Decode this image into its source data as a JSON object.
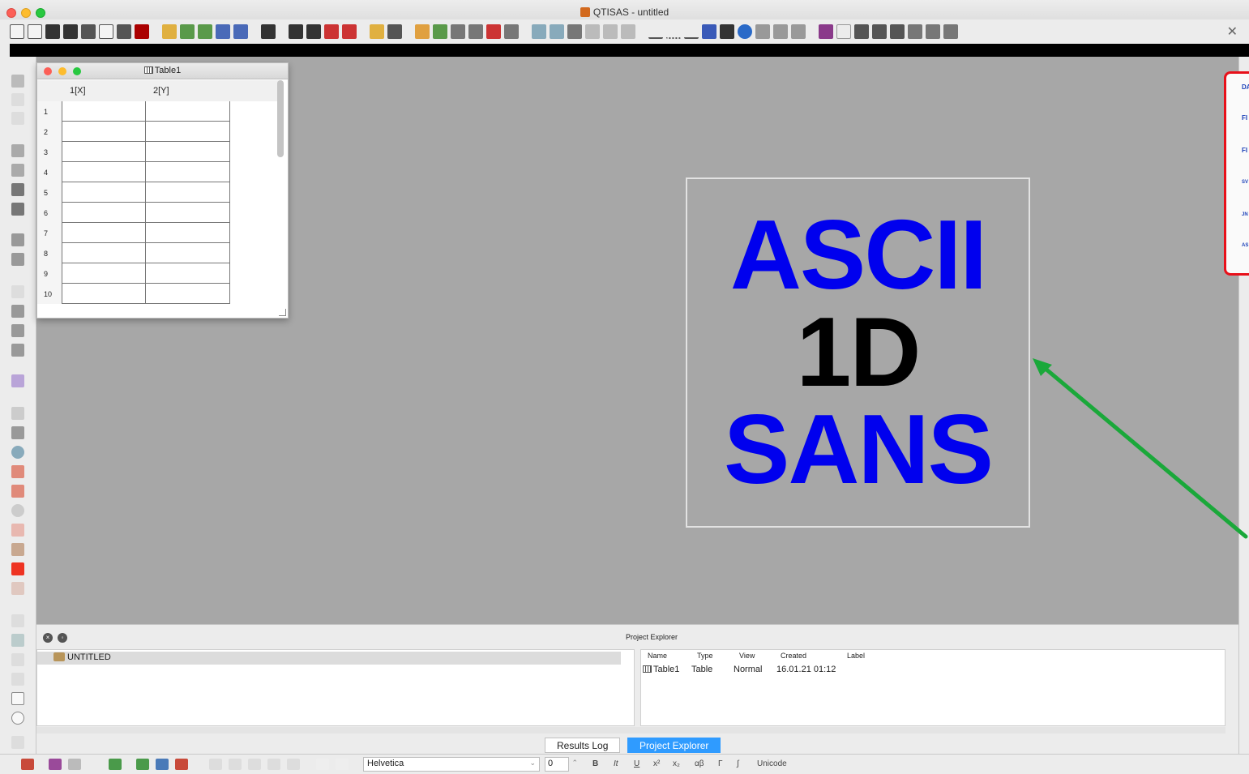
{
  "window": {
    "title": "QTISAS - untitled"
  },
  "table_window": {
    "title": "Table1",
    "columns": [
      "1[X]",
      "2[Y]"
    ],
    "rows": [
      "1",
      "2",
      "3",
      "4",
      "5",
      "6",
      "7",
      "8",
      "9",
      "10"
    ]
  },
  "logo": {
    "line1": "ASCII",
    "line2": "1D",
    "line3": "SANS"
  },
  "project_explorer": {
    "title": "Project Explorer",
    "root_folder": "UNTITLED",
    "headers": [
      "Name",
      "Type",
      "View",
      "Created",
      "Label"
    ],
    "items": [
      {
        "name": "Table1",
        "type": "Table",
        "view": "Normal",
        "created": "16.01.21 01:12",
        "label": ""
      }
    ]
  },
  "tabs": {
    "results_log": "Results Log",
    "project_explorer": "Project Explorer"
  },
  "format_bar": {
    "font_family": "Helvetica",
    "font_size": "0",
    "bold": "B",
    "italic": "It",
    "underline": "U",
    "superscript": "x²",
    "subscript": "x₂",
    "greek": "αβ",
    "greek_upper": "Γ",
    "integral": "∫",
    "unicode": "Unicode"
  },
  "right_panel": {
    "items": [
      "DA",
      "FI",
      "FI",
      "SV",
      "JN",
      "AS"
    ]
  },
  "colors": {
    "workspace": "#a7a7a7",
    "logo_blue": "#0000ee",
    "annotation_red": "#e8101a",
    "annotation_green": "#1aa83a",
    "active_tab": "#2f9bff"
  }
}
